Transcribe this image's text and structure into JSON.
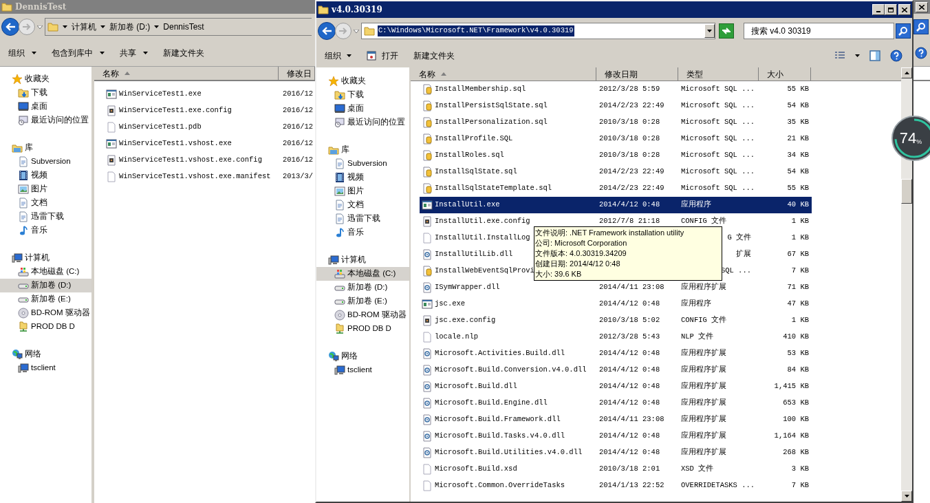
{
  "back_window": {
    "title": "DennisTest",
    "breadcrumb": [
      "计算机",
      "新加卷 (D:)",
      "DennisTest"
    ],
    "toolbar": [
      {
        "label": "组织",
        "dropdown": true
      },
      {
        "label": "包含到库中",
        "dropdown": true
      },
      {
        "label": "共享",
        "dropdown": true
      },
      {
        "label": "新建文件夹",
        "dropdown": false
      }
    ],
    "nav": [
      {
        "label": "收藏夹",
        "selected": false,
        "children": [
          {
            "label": "下载",
            "selected": false
          },
          {
            "label": "桌面",
            "selected": false
          },
          {
            "label": "最近访问的位置",
            "selected": false
          }
        ]
      },
      {
        "label": "库",
        "selected": false,
        "children": [
          {
            "label": "Subversion",
            "selected": false
          },
          {
            "label": "视频",
            "selected": false
          },
          {
            "label": "图片",
            "selected": false
          },
          {
            "label": "文档",
            "selected": false
          },
          {
            "label": "迅雷下载",
            "selected": false
          },
          {
            "label": "音乐",
            "selected": false
          }
        ]
      },
      {
        "label": "计算机",
        "selected": false,
        "children": [
          {
            "label": "本地磁盘 (C:)",
            "selected": false
          },
          {
            "label": "新加卷 (D:)",
            "selected": true
          },
          {
            "label": "新加卷 (E:)",
            "selected": false
          },
          {
            "label": "BD-ROM 驱动器",
            "selected": false
          },
          {
            "label": "PROD DB D",
            "selected": false
          }
        ]
      },
      {
        "label": "网络",
        "selected": false,
        "children": [
          {
            "label": "tsclient",
            "selected": false
          }
        ]
      }
    ],
    "columns": [
      {
        "label": "名称",
        "sorted": true
      },
      {
        "label": "修改日",
        "sorted": false
      }
    ],
    "files": [
      {
        "kind": "exe",
        "name": "WinServiceTest1.exe",
        "date": "2016/12",
        "selected": false
      },
      {
        "kind": "config",
        "name": "WinServiceTest1.exe.config",
        "date": "2016/12",
        "selected": false
      },
      {
        "kind": "blank",
        "name": "WinServiceTest1.pdb",
        "date": "2016/12",
        "selected": false
      },
      {
        "kind": "exe",
        "name": "WinServiceTest1.vshost.exe",
        "date": "2016/12",
        "selected": false
      },
      {
        "kind": "config",
        "name": "WinServiceTest1.vshost.exe.config",
        "date": "2016/12",
        "selected": false
      },
      {
        "kind": "blank",
        "name": "WinServiceTest1.vshost.exe.manifest",
        "date": "2013/3/",
        "selected": false
      }
    ]
  },
  "front_window": {
    "title": "v4.0.30319",
    "address": "C:\\Windows\\Microsoft.NET\\Framework\\v4.0.30319",
    "search": {
      "placeholder": "搜索 v4.0 30319"
    },
    "toolbar": [
      {
        "label": "组织",
        "kind": "menu"
      },
      {
        "label": "打开",
        "kind": "open"
      },
      {
        "label": "新建文件夹",
        "kind": "plain"
      }
    ],
    "nav": [
      {
        "label": "收藏夹",
        "selected": false,
        "children": [
          {
            "label": "下载",
            "selected": false
          },
          {
            "label": "桌面",
            "selected": false
          },
          {
            "label": "最近访问的位置",
            "selected": false
          }
        ]
      },
      {
        "label": "库",
        "selected": false,
        "children": [
          {
            "label": "Subversion",
            "selected": false
          },
          {
            "label": "视频",
            "selected": false
          },
          {
            "label": "图片",
            "selected": false
          },
          {
            "label": "文档",
            "selected": false
          },
          {
            "label": "迅雷下载",
            "selected": false
          },
          {
            "label": "音乐",
            "selected": false
          }
        ]
      },
      {
        "label": "计算机",
        "selected": false,
        "children": [
          {
            "label": "本地磁盘 (C:)",
            "selected": true
          },
          {
            "label": "新加卷 (D:)",
            "selected": false
          },
          {
            "label": "新加卷 (E:)",
            "selected": false
          },
          {
            "label": "BD-ROM 驱动器",
            "selected": false
          },
          {
            "label": "PROD DB D",
            "selected": false
          }
        ]
      },
      {
        "label": "网络",
        "selected": false,
        "children": [
          {
            "label": "tsclient",
            "selected": false
          }
        ]
      }
    ],
    "columns": [
      {
        "label": "名称",
        "sorted": true
      },
      {
        "label": "修改日期",
        "sorted": false
      },
      {
        "label": "类型",
        "sorted": false
      },
      {
        "label": "大小",
        "sorted": false
      }
    ],
    "files": [
      {
        "kind": "sql",
        "name": "InstallMembership.sql",
        "date": "2012/3/28 5:59",
        "type": "Microsoft SQL ...",
        "size": "55 KB",
        "selected": false
      },
      {
        "kind": "sql",
        "name": "InstallPersistSqlState.sql",
        "date": "2014/2/23 22:49",
        "type": "Microsoft SQL ...",
        "size": "54 KB",
        "selected": false
      },
      {
        "kind": "sql",
        "name": "InstallPersonalization.sql",
        "date": "2010/3/18 0:28",
        "type": "Microsoft SQL ...",
        "size": "35 KB",
        "selected": false
      },
      {
        "kind": "sql",
        "name": "InstallProfile.SQL",
        "date": "2010/3/18 0:28",
        "type": "Microsoft SQL ...",
        "size": "21 KB",
        "selected": false
      },
      {
        "kind": "sql",
        "name": "InstallRoles.sql",
        "date": "2010/3/18 0:28",
        "type": "Microsoft SQL ...",
        "size": "34 KB",
        "selected": false
      },
      {
        "kind": "sql",
        "name": "InstallSqlState.sql",
        "date": "2014/2/23 22:49",
        "type": "Microsoft SQL ...",
        "size": "54 KB",
        "selected": false
      },
      {
        "kind": "sql",
        "name": "InstallSqlStateTemplate.sql",
        "date": "2014/2/23 22:49",
        "type": "Microsoft SQL ...",
        "size": "55 KB",
        "selected": false
      },
      {
        "kind": "exe",
        "name": "InstallUtil.exe",
        "date": "2014/4/12 0:48",
        "type": "应用程序",
        "size": "40 KB",
        "selected": true
      },
      {
        "kind": "config",
        "name": "InstallUtil.exe.config",
        "date": "2012/7/8 21:18",
        "type": "CONFIG 文件",
        "size": "1 KB",
        "selected": false
      },
      {
        "kind": "blank",
        "name": "InstallUtil.InstallLog",
        "type_tail": "G 文件",
        "size": "1 KB",
        "selected": false
      },
      {
        "kind": "dll",
        "name": "InstallUtilLib.dll",
        "type_tail": "扩展",
        "size": "67 KB",
        "selected": false
      },
      {
        "kind": "sql",
        "name": "InstallWebEventSqlProvi",
        "type_tail": "SQL ...",
        "size": "7 KB",
        "selected": false
      },
      {
        "kind": "dll",
        "name": "ISymWrapper.dll",
        "date": "2014/4/11 23:08",
        "type": "应用程序扩展",
        "size": "71 KB",
        "selected": false
      },
      {
        "kind": "exe",
        "name": "jsc.exe",
        "date": "2014/4/12 0:48",
        "type": "应用程序",
        "size": "47 KB",
        "selected": false
      },
      {
        "kind": "config",
        "name": "jsc.exe.config",
        "date": "2010/3/18 5:02",
        "type": "CONFIG 文件",
        "size": "1 KB",
        "selected": false
      },
      {
        "kind": "blank",
        "name": "locale.nlp",
        "date": "2012/3/28 5:43",
        "type": "NLP 文件",
        "size": "410 KB",
        "selected": false
      },
      {
        "kind": "dll",
        "name": "Microsoft.Activities.Build.dll",
        "date": "2014/4/12 0:48",
        "type": "应用程序扩展",
        "size": "53 KB",
        "selected": false
      },
      {
        "kind": "dll",
        "name": "Microsoft.Build.Conversion.v4.0.dll",
        "date": "2014/4/12 0:48",
        "type": "应用程序扩展",
        "size": "84 KB",
        "selected": false
      },
      {
        "kind": "dll",
        "name": "Microsoft.Build.dll",
        "date": "2014/4/12 0:48",
        "type": "应用程序扩展",
        "size": "1,415 KB",
        "selected": false
      },
      {
        "kind": "dll",
        "name": "Microsoft.Build.Engine.dll",
        "date": "2014/4/12 0:48",
        "type": "应用程序扩展",
        "size": "653 KB",
        "selected": false
      },
      {
        "kind": "dll",
        "name": "Microsoft.Build.Framework.dll",
        "date": "2014/4/11 23:08",
        "type": "应用程序扩展",
        "size": "100 KB",
        "selected": false
      },
      {
        "kind": "dll",
        "name": "Microsoft.Build.Tasks.v4.0.dll",
        "date": "2014/4/12 0:48",
        "type": "应用程序扩展",
        "size": "1,164 KB",
        "selected": false
      },
      {
        "kind": "dll",
        "name": "Microsoft.Build.Utilities.v4.0.dll",
        "date": "2014/4/12 0:48",
        "type": "应用程序扩展",
        "size": "268 KB",
        "selected": false
      },
      {
        "kind": "blank",
        "name": "Microsoft.Build.xsd",
        "date": "2010/3/18 2:01",
        "type": "XSD 文件",
        "size": "3 KB",
        "selected": false
      },
      {
        "kind": "blank",
        "name": "Microsoft.Common.OverrideTasks",
        "date": "2014/1/13 22:52",
        "type": "OVERRIDETASKS ...",
        "size": "7 KB",
        "selected": false
      }
    ],
    "tooltip": [
      "文件说明: .NET Framework installation utility",
      "公司: Microsoft Corporation",
      "文件版本: 4.0.30319.34209",
      "创建日期: 2014/4/12 0:48",
      "大小: 39.6 KB"
    ]
  },
  "gadget": {
    "value": "74",
    "unit": "%"
  }
}
